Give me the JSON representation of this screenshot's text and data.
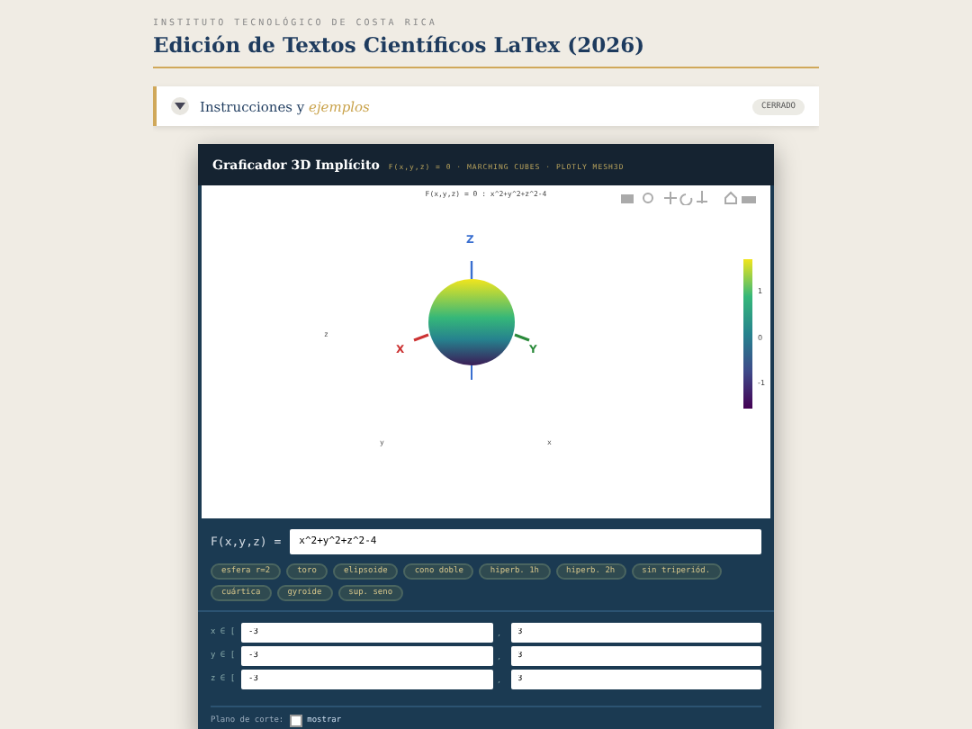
{
  "header": {
    "institution": "INSTITUTO TECNOLÓGICO DE COSTA RICA",
    "title": "Edición de Textos Científicos LaTex (2026)"
  },
  "accordion": {
    "label": "Instrucciones y **ejemplos**",
    "status": "CERRADO",
    "expanded": false
  },
  "plotter": {
    "title": "Graficador 3D Implícito",
    "subtitle": "F(x,y,z) = 0 · MARCHING CUBES · PLOTLY MESH3D",
    "plot": {
      "title": "F(x,y,z) = 0 : x^2+y^2+z^2-4",
      "axis_labels": [
        "Z",
        "X",
        "Y"
      ],
      "scene_labels": [
        "z",
        "y",
        "x"
      ],
      "colorbar_ticks": [
        "1",
        "0",
        "-1"
      ]
    },
    "function_label": "F(x,y,z) =",
    "function_value": "x^2+y^2+z^2-4",
    "presets": [
      "esfera r=2",
      "toro",
      "elipsoide",
      "cono doble",
      "hiperb. 1h",
      "hiperb. 2h",
      "sin triperiód.",
      "cuártica",
      "gyroide",
      "sup. seno"
    ],
    "ranges": [
      {
        "label": "x ∈ [",
        "sep": ",",
        "min": "-3",
        "max": "3"
      },
      {
        "label": "y ∈ [",
        "sep": ",",
        "min": "-3",
        "max": "3"
      },
      {
        "label": "z ∈ [",
        "sep": ",",
        "min": "-3",
        "max": "3"
      }
    ],
    "cut_plane": {
      "label": "Plano de corte:",
      "option": "mostrar",
      "checked": false
    }
  }
}
